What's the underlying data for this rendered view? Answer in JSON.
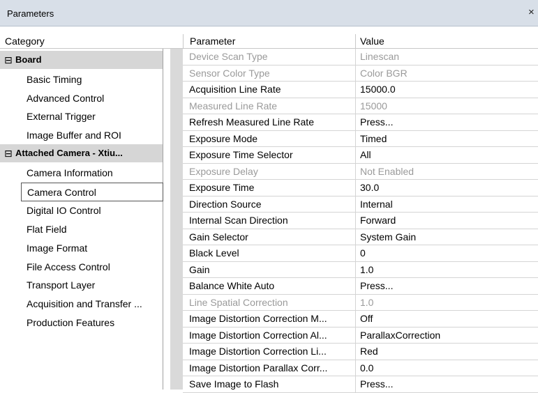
{
  "window": {
    "title": "Parameters",
    "close_glyph": "×"
  },
  "headers": {
    "category": "Category",
    "parameter": "Parameter",
    "value": "Value"
  },
  "categories": {
    "board": {
      "toggle": "⊟",
      "label": "Board",
      "items": [
        "Basic Timing",
        "Advanced Control",
        "External Trigger",
        "Image Buffer and ROI"
      ]
    },
    "camera": {
      "toggle": "⊟",
      "label": "Attached Camera - Xtiu...",
      "items": [
        "Camera Information",
        "Camera Control",
        "Digital IO Control",
        "Flat Field",
        "Image Format",
        "File Access Control",
        "Transport Layer",
        "Acquisition and Transfer ...",
        "Production Features"
      ],
      "selected": "Camera Control"
    }
  },
  "parameters": [
    {
      "name": "Device Scan Type",
      "value": "Linescan",
      "enabled": false
    },
    {
      "name": "Sensor Color Type",
      "value": "Color BGR",
      "enabled": false
    },
    {
      "name": "Acquisition Line Rate",
      "value": "15000.0",
      "enabled": true
    },
    {
      "name": "Measured Line Rate",
      "value": "15000",
      "enabled": false
    },
    {
      "name": "Refresh Measured Line Rate",
      "value": "Press...",
      "enabled": true
    },
    {
      "name": "Exposure Mode",
      "value": "Timed",
      "enabled": true
    },
    {
      "name": "Exposure Time Selector",
      "value": "All",
      "enabled": true
    },
    {
      "name": "Exposure Delay",
      "value": "Not Enabled",
      "enabled": false
    },
    {
      "name": "Exposure Time",
      "value": "30.0",
      "enabled": true
    },
    {
      "name": "Direction Source",
      "value": "Internal",
      "enabled": true
    },
    {
      "name": "Internal Scan Direction",
      "value": "Forward",
      "enabled": true
    },
    {
      "name": "Gain Selector",
      "value": "System Gain",
      "enabled": true
    },
    {
      "name": "Black Level",
      "value": "0",
      "enabled": true
    },
    {
      "name": "Gain",
      "value": "1.0",
      "enabled": true
    },
    {
      "name": "Balance White Auto",
      "value": "Press...",
      "enabled": true
    },
    {
      "name": "Line Spatial Correction",
      "value": "1.0",
      "enabled": false
    },
    {
      "name": "Image Distortion Correction M...",
      "value": "Off",
      "enabled": true
    },
    {
      "name": "Image Distortion Correction Al...",
      "value": "ParallaxCorrection",
      "enabled": true
    },
    {
      "name": "Image Distortion Correction Li...",
      "value": "Red",
      "enabled": true
    },
    {
      "name": "Image Distortion Parallax Corr...",
      "value": "0.0",
      "enabled": true
    },
    {
      "name": "Save Image to Flash",
      "value": "Press...",
      "enabled": true
    }
  ]
}
